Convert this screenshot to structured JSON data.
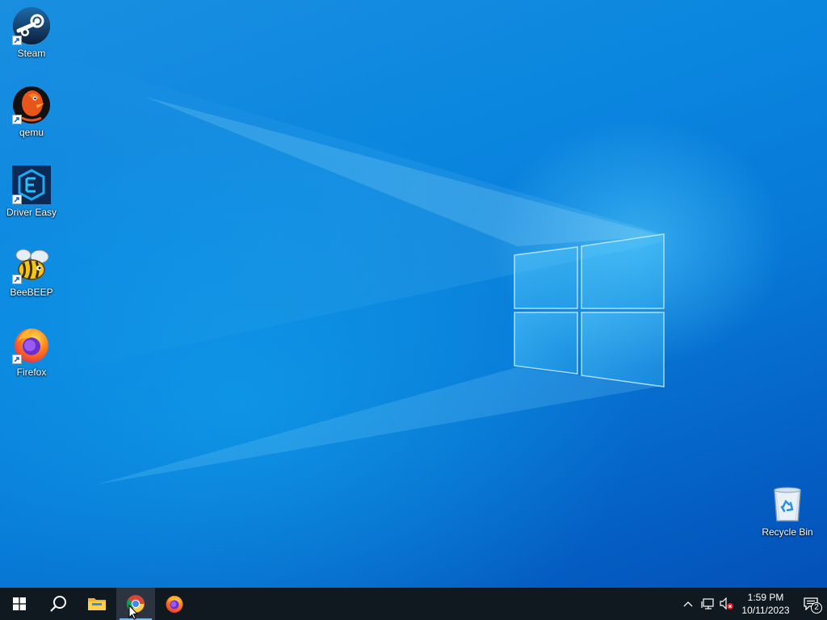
{
  "desktop": {
    "icons": [
      {
        "label": "Steam",
        "icon": "steam-icon"
      },
      {
        "label": "qemu",
        "icon": "qemu-icon"
      },
      {
        "label": "Driver Easy",
        "icon": "driver-easy-icon"
      },
      {
        "label": "BeeBEEP",
        "icon": "beebeep-icon"
      },
      {
        "label": "Firefox",
        "icon": "firefox-icon"
      },
      {
        "label": "Recycle Bin",
        "icon": "recycle-bin-icon"
      }
    ]
  },
  "taskbar": {
    "items": [
      {
        "name": "start",
        "icon": "windows-logo-icon"
      },
      {
        "name": "search",
        "icon": "search-icon"
      },
      {
        "name": "file-explorer",
        "icon": "folder-icon"
      },
      {
        "name": "chrome",
        "icon": "chrome-icon",
        "active": true
      },
      {
        "name": "firefox",
        "icon": "firefox-icon"
      }
    ],
    "tray": {
      "icons": [
        "chevron-up-icon",
        "network-icon",
        "volume-muted-icon"
      ],
      "time": "1:59 PM",
      "date": "10/11/2023",
      "notification_count": "2"
    }
  },
  "colors": {
    "taskbar": "#101820",
    "desktop_blue": "#0a7ad6",
    "active_underline": "#76b9ed"
  }
}
